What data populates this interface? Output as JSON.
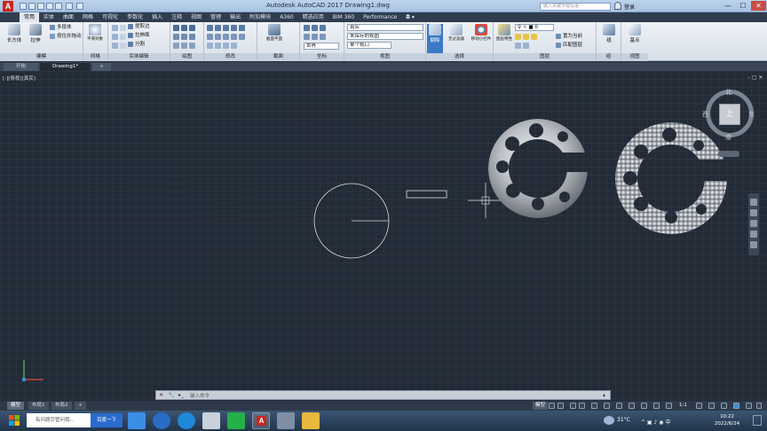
{
  "window": {
    "title": "Autodesk AutoCAD 2017    Drawing1.dwg",
    "app_logo": "A",
    "search_placeholder": "键入关键字或短语",
    "user": "登录",
    "controls": {
      "minimize": "—",
      "maximize": "☐",
      "close": "✕"
    }
  },
  "ribbon_tabs": [
    "常用",
    "实体",
    "曲面",
    "网格",
    "可视化",
    "参数化",
    "插入",
    "注释",
    "视图",
    "管理",
    "输出",
    "附加模块",
    "A360",
    "精选应用",
    "BIM 360",
    "Performance"
  ],
  "ribbon_active_tab": "常用",
  "panels": {
    "modeling": {
      "label": "建模",
      "box": "长方体",
      "extrude": "拉伸",
      "small": [
        "多段体",
        "按住并拖动"
      ]
    },
    "mesh": {
      "label": "网格",
      "btn": "平滑对象"
    },
    "solid_edit": {
      "label": "实体编辑",
      "rows": [
        "提取边",
        "拉伸面",
        "分割"
      ]
    },
    "draw": {
      "label": "绘图"
    },
    "modify": {
      "label": "修改"
    },
    "section": {
      "label": "截面",
      "btn": "截面平面"
    },
    "coordinates": {
      "label": "坐标",
      "world": "世界"
    },
    "view": {
      "label": "视图",
      "visual_style": "真实",
      "saved_view": "未保存的视图",
      "viewport": "单个视口"
    },
    "selection": {
      "label": "选择",
      "culling": "剔除",
      "filter": "无过滤器",
      "gizmo": "移动小控件"
    },
    "layers": {
      "label": "图层",
      "props": "图层特性",
      "current": "置为当前",
      "match": "匹配图层"
    },
    "groups": {
      "label": "组",
      "group": "组"
    },
    "viewpanel": {
      "label": "视图",
      "base": "基点"
    }
  },
  "doc_tabs": [
    "开始",
    "Drawing1*",
    "+"
  ],
  "viewport_label": "[-][俯视][真实]",
  "viewcube": {
    "top": "上",
    "north": "北",
    "south": "南",
    "west": "西",
    "east": "东"
  },
  "command": {
    "placeholder": "键入命令"
  },
  "layout_tabs": [
    "模型",
    "布局1",
    "布局2",
    "+"
  ],
  "status": {
    "model": "模型",
    "scale": "1:1"
  },
  "taskbar": {
    "search": "有问题尽管问我...",
    "baidu": "百度一下",
    "temperature": "31°C",
    "time": "10:22",
    "date": "2022/6/24"
  }
}
